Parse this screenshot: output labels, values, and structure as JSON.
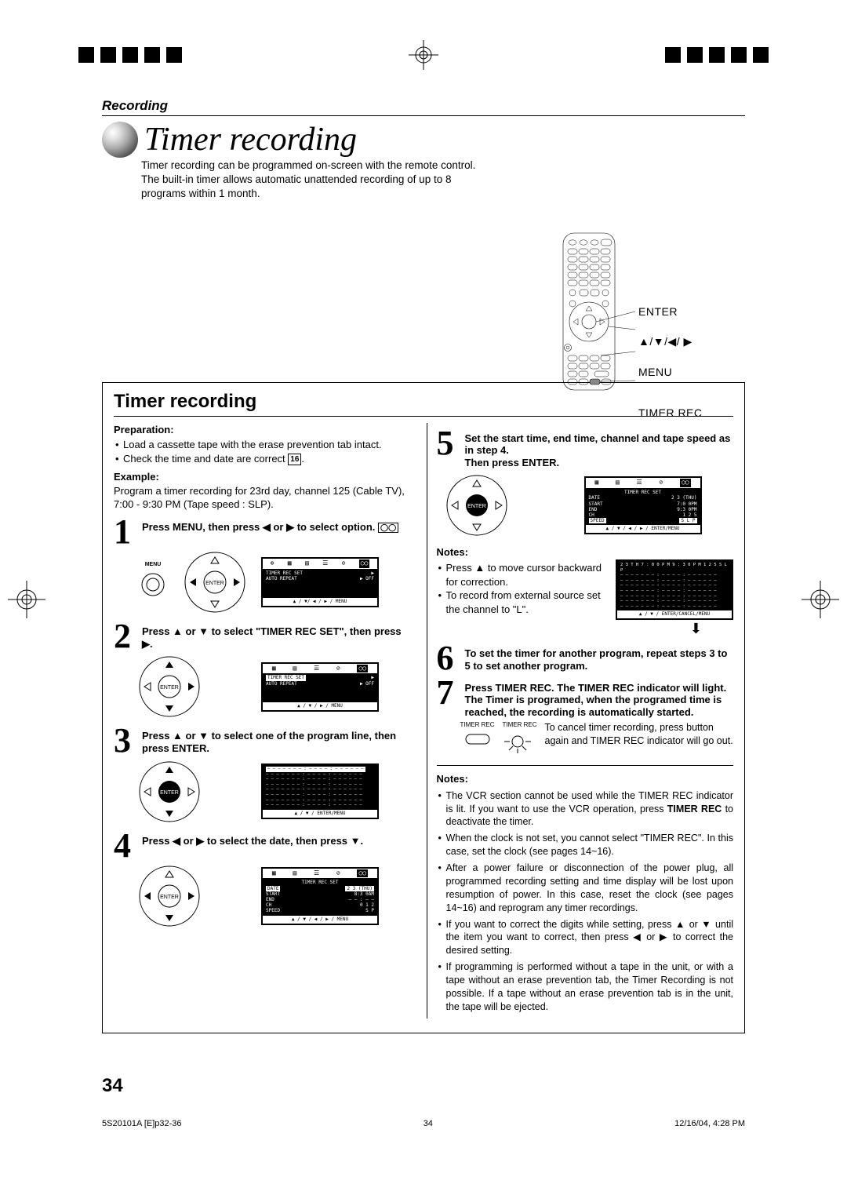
{
  "pageNumber": "34",
  "sectionLabel": "Recording",
  "title_script": "Timer recording",
  "intro": "Timer recording can be programmed on-screen with the remote control. The built-in timer allows automatic unattended recording of up to 8 programs within 1 month.",
  "remote_labels": {
    "enter": "ENTER",
    "arrows": "▲/▼/◀/ ▶",
    "menu": "MENU",
    "timer_rec": "TIMER REC"
  },
  "instr_title": "Timer recording",
  "leftCol": {
    "prep_heading": "Preparation:",
    "prep_items": [
      "Load a cassette tape with the erase prevention tab intact.",
      "Check the time and date are correct"
    ],
    "prep_page_ref": "16",
    "example_heading": "Example:",
    "example_text": "Program a timer recording for 23rd day, channel 125 (Cable TV), 7:00 - 9:30 PM (Tape speed : SLP).",
    "step1": "Press MENU, then press ◀ or ▶ to select        option.",
    "menu_label": "MENU",
    "enter_badge": "ENTER",
    "screen1": {
      "rows": [
        [
          "TIMER  REC  SET",
          "▶"
        ],
        [
          "AUTO   REPEAT",
          "▶ OFF"
        ]
      ],
      "foot": "▲ / ▼/ ◀ / ▶ / MENU"
    },
    "step2": "Press ▲ or ▼ to select \"TIMER REC SET\", then press ▶.",
    "screen2": {
      "rows": [
        [
          "TIMER  REC  SET",
          "▶"
        ],
        [
          "AUTO   REPEAT",
          "▶ OFF"
        ]
      ],
      "foot": "▲ / ▼ /  ▶ / MENU"
    },
    "step3": "Press ▲ or ▼ to select one of the program line, then press ENTER.",
    "screen3": {
      "body_dashes": "– – – – –   – –  : – –      – – : – –    – – –    –",
      "foot": "▲ / ▼ / ENTER/MENU"
    },
    "step4": "Press ◀ or ▶ to select the date, then press ▼.",
    "screen4": {
      "title": "TIMER  REC  SET",
      "rows": [
        [
          "DATE",
          "2 3 (THU)"
        ],
        [
          "START",
          "8:3 0AM"
        ],
        [
          "END",
          "– – : – –"
        ],
        [
          "CH",
          "0 1 2"
        ],
        [
          "SPEED",
          "S P"
        ]
      ],
      "foot": "▲ / ▼ / ◀ / ▶ /  MENU"
    }
  },
  "rightCol": {
    "step5": "Set the start time, end time, channel and tape speed as in step 4.",
    "step5b": "Then press ENTER.",
    "screen5": {
      "title": "TIMER  REC  SET",
      "rows": [
        [
          "DATE",
          "2 3 (THU)"
        ],
        [
          "START",
          "7:0 0PM"
        ],
        [
          "END",
          "9:3 0PM"
        ],
        [
          "CH",
          "1 2 5"
        ],
        [
          "SPEED",
          "S L P"
        ]
      ],
      "foot": "▲ / ▼ / ◀ / ▶ / ENTER/MENU"
    },
    "notes_heading": "Notes:",
    "notes5": [
      "Press ▲ to move cursor backward for correction.",
      "To record from external source set the channel to \"L\"."
    ],
    "screen_list": {
      "header": "2 3   T H   7 : 0 0 P M  9 : 3 0 P M 1 2 5   S L P",
      "dash": "– – – – –   – – : – –      – – : – –   – – –   –",
      "foot": "▲ / ▼ / ENTER/CANCEL/MENU"
    },
    "step6": "To set the timer for another program, repeat steps 3 to 5 to set another program.",
    "step7": "Press TIMER REC. The TIMER REC indicator will light. The Timer is programed, when the programed time is reached, the recording is automatically started.",
    "cancel_text": "To cancel timer recording, press button again and TIMER REC indicator will go out.",
    "led_label": "TIMER REC",
    "notes_bottom_heading": "Notes:",
    "timer_rec_emph": "TIMER REC",
    "notes_bottom": [
      "The VCR section cannot be used while the TIMER REC indicator is lit. If you want to use the VCR operation, press TIMER REC to deactivate the timer.",
      "When the clock is not set, you cannot select \"TIMER REC\". In this case, set the clock (see pages 14~16).",
      "After a power failure or disconnection of the power plug, all programmed recording setting and time display will be  lost upon resumption of power. In this case, reset the clock (see pages 14~16) and reprogram any timer recordings.",
      "If you want to correct the digits while setting, press ▲ or ▼ until the item you want to correct, then press ◀ or ▶ to correct the desired setting.",
      "If programming is performed without a tape in the unit, or with a tape without an erase prevention tab, the Timer Recording is not possible. If a tape without an erase prevention tab is in the unit, the tape will be ejected."
    ]
  },
  "footer": {
    "file": "5S20101A [E]p32-36",
    "centerNum": "34",
    "date": "12/16/04, 4:28 PM"
  }
}
